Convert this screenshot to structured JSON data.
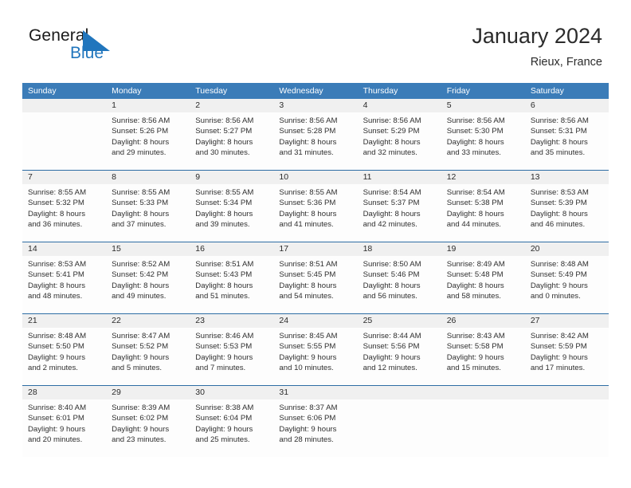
{
  "brand": {
    "name_part1": "General",
    "name_part2": "Blue",
    "triangle_color": "#2176bd"
  },
  "header": {
    "title": "January 2024",
    "subtitle": "Rieux, France"
  },
  "colors": {
    "header_blue": "#3b7cb8",
    "divider_blue": "#2e6da4",
    "number_band": "#f0f0f0",
    "text": "#2f2f2f"
  },
  "weekdays": [
    "Sunday",
    "Monday",
    "Tuesday",
    "Wednesday",
    "Thursday",
    "Friday",
    "Saturday"
  ],
  "weeks": [
    [
      {
        "day": "",
        "lines": []
      },
      {
        "day": "1",
        "lines": [
          "Sunrise: 8:56 AM",
          "Sunset: 5:26 PM",
          "Daylight: 8 hours",
          "and 29 minutes."
        ]
      },
      {
        "day": "2",
        "lines": [
          "Sunrise: 8:56 AM",
          "Sunset: 5:27 PM",
          "Daylight: 8 hours",
          "and 30 minutes."
        ]
      },
      {
        "day": "3",
        "lines": [
          "Sunrise: 8:56 AM",
          "Sunset: 5:28 PM",
          "Daylight: 8 hours",
          "and 31 minutes."
        ]
      },
      {
        "day": "4",
        "lines": [
          "Sunrise: 8:56 AM",
          "Sunset: 5:29 PM",
          "Daylight: 8 hours",
          "and 32 minutes."
        ]
      },
      {
        "day": "5",
        "lines": [
          "Sunrise: 8:56 AM",
          "Sunset: 5:30 PM",
          "Daylight: 8 hours",
          "and 33 minutes."
        ]
      },
      {
        "day": "6",
        "lines": [
          "Sunrise: 8:56 AM",
          "Sunset: 5:31 PM",
          "Daylight: 8 hours",
          "and 35 minutes."
        ]
      }
    ],
    [
      {
        "day": "7",
        "lines": [
          "Sunrise: 8:55 AM",
          "Sunset: 5:32 PM",
          "Daylight: 8 hours",
          "and 36 minutes."
        ]
      },
      {
        "day": "8",
        "lines": [
          "Sunrise: 8:55 AM",
          "Sunset: 5:33 PM",
          "Daylight: 8 hours",
          "and 37 minutes."
        ]
      },
      {
        "day": "9",
        "lines": [
          "Sunrise: 8:55 AM",
          "Sunset: 5:34 PM",
          "Daylight: 8 hours",
          "and 39 minutes."
        ]
      },
      {
        "day": "10",
        "lines": [
          "Sunrise: 8:55 AM",
          "Sunset: 5:36 PM",
          "Daylight: 8 hours",
          "and 41 minutes."
        ]
      },
      {
        "day": "11",
        "lines": [
          "Sunrise: 8:54 AM",
          "Sunset: 5:37 PM",
          "Daylight: 8 hours",
          "and 42 minutes."
        ]
      },
      {
        "day": "12",
        "lines": [
          "Sunrise: 8:54 AM",
          "Sunset: 5:38 PM",
          "Daylight: 8 hours",
          "and 44 minutes."
        ]
      },
      {
        "day": "13",
        "lines": [
          "Sunrise: 8:53 AM",
          "Sunset: 5:39 PM",
          "Daylight: 8 hours",
          "and 46 minutes."
        ]
      }
    ],
    [
      {
        "day": "14",
        "lines": [
          "Sunrise: 8:53 AM",
          "Sunset: 5:41 PM",
          "Daylight: 8 hours",
          "and 48 minutes."
        ]
      },
      {
        "day": "15",
        "lines": [
          "Sunrise: 8:52 AM",
          "Sunset: 5:42 PM",
          "Daylight: 8 hours",
          "and 49 minutes."
        ]
      },
      {
        "day": "16",
        "lines": [
          "Sunrise: 8:51 AM",
          "Sunset: 5:43 PM",
          "Daylight: 8 hours",
          "and 51 minutes."
        ]
      },
      {
        "day": "17",
        "lines": [
          "Sunrise: 8:51 AM",
          "Sunset: 5:45 PM",
          "Daylight: 8 hours",
          "and 54 minutes."
        ]
      },
      {
        "day": "18",
        "lines": [
          "Sunrise: 8:50 AM",
          "Sunset: 5:46 PM",
          "Daylight: 8 hours",
          "and 56 minutes."
        ]
      },
      {
        "day": "19",
        "lines": [
          "Sunrise: 8:49 AM",
          "Sunset: 5:48 PM",
          "Daylight: 8 hours",
          "and 58 minutes."
        ]
      },
      {
        "day": "20",
        "lines": [
          "Sunrise: 8:48 AM",
          "Sunset: 5:49 PM",
          "Daylight: 9 hours",
          "and 0 minutes."
        ]
      }
    ],
    [
      {
        "day": "21",
        "lines": [
          "Sunrise: 8:48 AM",
          "Sunset: 5:50 PM",
          "Daylight: 9 hours",
          "and 2 minutes."
        ]
      },
      {
        "day": "22",
        "lines": [
          "Sunrise: 8:47 AM",
          "Sunset: 5:52 PM",
          "Daylight: 9 hours",
          "and 5 minutes."
        ]
      },
      {
        "day": "23",
        "lines": [
          "Sunrise: 8:46 AM",
          "Sunset: 5:53 PM",
          "Daylight: 9 hours",
          "and 7 minutes."
        ]
      },
      {
        "day": "24",
        "lines": [
          "Sunrise: 8:45 AM",
          "Sunset: 5:55 PM",
          "Daylight: 9 hours",
          "and 10 minutes."
        ]
      },
      {
        "day": "25",
        "lines": [
          "Sunrise: 8:44 AM",
          "Sunset: 5:56 PM",
          "Daylight: 9 hours",
          "and 12 minutes."
        ]
      },
      {
        "day": "26",
        "lines": [
          "Sunrise: 8:43 AM",
          "Sunset: 5:58 PM",
          "Daylight: 9 hours",
          "and 15 minutes."
        ]
      },
      {
        "day": "27",
        "lines": [
          "Sunrise: 8:42 AM",
          "Sunset: 5:59 PM",
          "Daylight: 9 hours",
          "and 17 minutes."
        ]
      }
    ],
    [
      {
        "day": "28",
        "lines": [
          "Sunrise: 8:40 AM",
          "Sunset: 6:01 PM",
          "Daylight: 9 hours",
          "and 20 minutes."
        ]
      },
      {
        "day": "29",
        "lines": [
          "Sunrise: 8:39 AM",
          "Sunset: 6:02 PM",
          "Daylight: 9 hours",
          "and 23 minutes."
        ]
      },
      {
        "day": "30",
        "lines": [
          "Sunrise: 8:38 AM",
          "Sunset: 6:04 PM",
          "Daylight: 9 hours",
          "and 25 minutes."
        ]
      },
      {
        "day": "31",
        "lines": [
          "Sunrise: 8:37 AM",
          "Sunset: 6:06 PM",
          "Daylight: 9 hours",
          "and 28 minutes."
        ]
      },
      {
        "day": "",
        "lines": []
      },
      {
        "day": "",
        "lines": []
      },
      {
        "day": "",
        "lines": []
      }
    ]
  ]
}
